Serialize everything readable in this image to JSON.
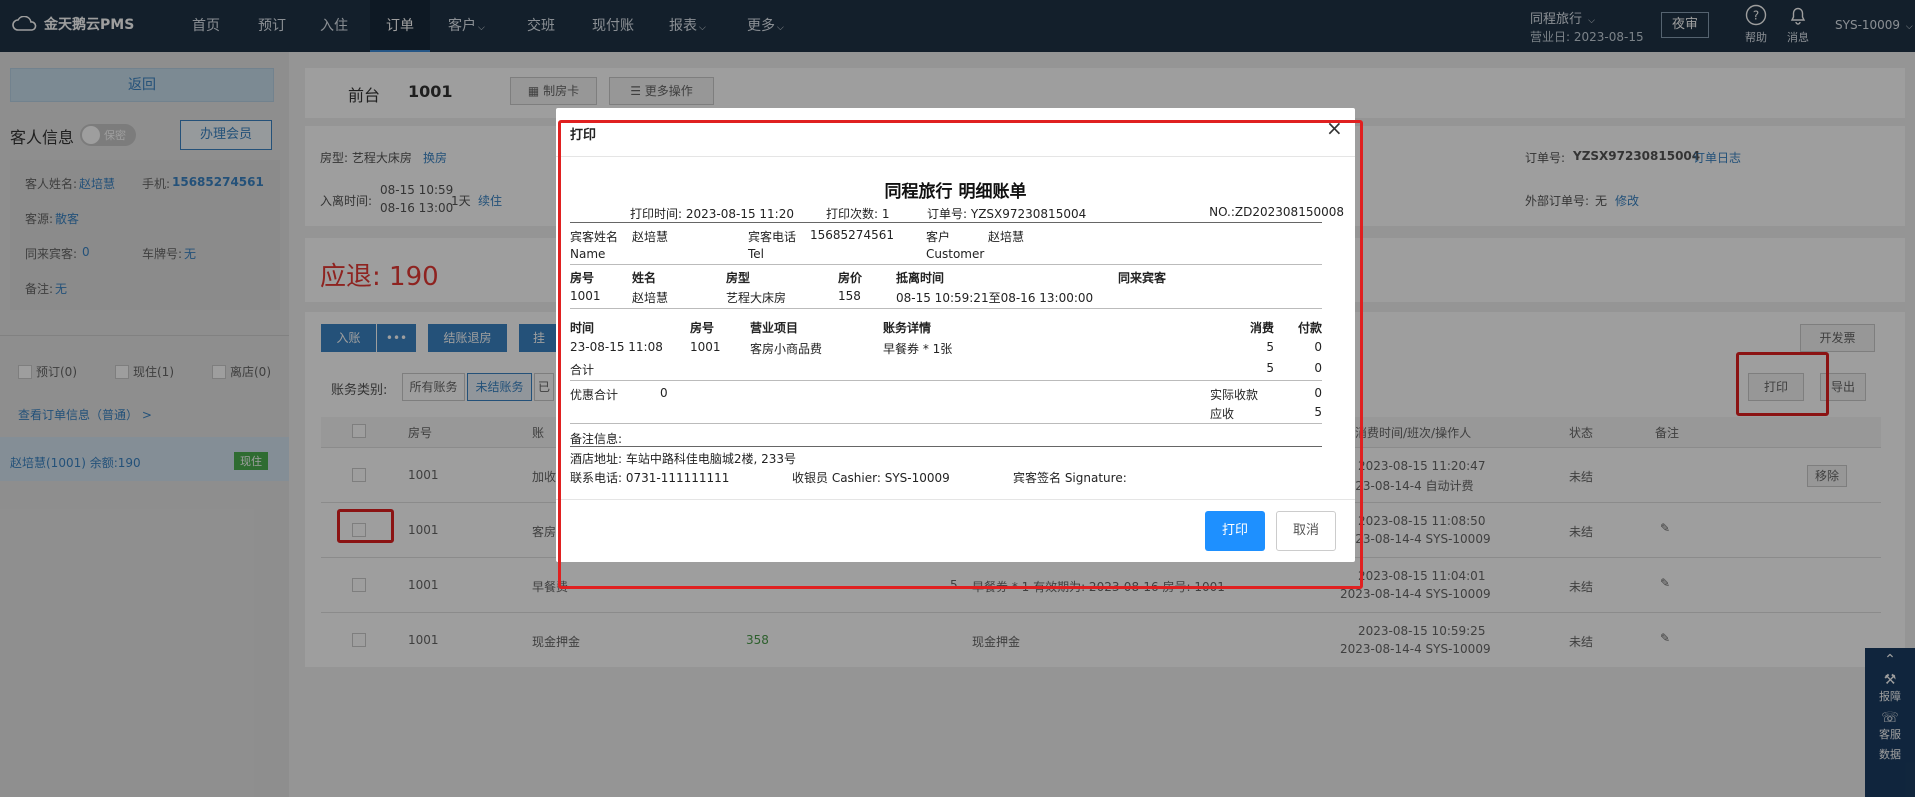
{
  "nav": {
    "logo": "金天鹅云PMS",
    "items": [
      "首页",
      "预订",
      "入住",
      "订单",
      "客户",
      "交班",
      "现付账",
      "报表",
      "更多"
    ],
    "active": "订单",
    "hotel": "同程旅行",
    "business_date": "营业日: 2023-08-15",
    "night_audit": "夜审",
    "help": "帮助",
    "message": "消息",
    "user": "SYS-10009"
  },
  "left": {
    "return": "返回",
    "guest_info": "客人信息",
    "secret": "保密",
    "member_btn": "办理会员",
    "guest_name_label": "客人姓名:",
    "guest_name": "赵培慧",
    "phone_label": "手机:",
    "phone": "15685274561",
    "source_label": "客源:",
    "source": "散客",
    "companion_label": "同来宾客:",
    "companion": "0",
    "plate_label": "车牌号:",
    "plate": "无",
    "remark_label": "备注:",
    "remark": "无",
    "filters": [
      "预订(0)",
      "现住(1)",
      "离店(0)"
    ],
    "order_info": "查看订单信息（普通） >",
    "guest_row": "赵培慧(1001)  余额:190",
    "guest_row_status": "现住"
  },
  "main": {
    "title": "前台",
    "room": "1001",
    "make_card": "制房卡",
    "more_ops": "更多操作",
    "room_type": "房型: 艺程大床房",
    "change_room": "换房",
    "checkin_label": "入离时间:",
    "checkin": "08-15 10:59",
    "checkout": "08-16 13:00",
    "nights": "1天",
    "extend": "续住",
    "order_no_label": "订单号:",
    "order_no": "YZSX97230815004",
    "order_log": "订单日志",
    "ext_order_label": "外部订单号:",
    "ext_order": "无",
    "modify": "修改",
    "refund": "应退: 190",
    "btn_post": "入账",
    "btn_settle": "结账退房",
    "btn_other": "挂",
    "btn_invoice": "开发票",
    "btn_print": "打印",
    "btn_export": "导出",
    "acct_type_label": "账务类别:",
    "acct_all": "所有账务",
    "acct_unsettled": "未结账务",
    "acct_settled": "已",
    "table": {
      "headers": [
        "房号",
        "账",
        "消费时间/班次/操作人",
        "状态",
        "备注"
      ],
      "rows": [
        {
          "room": "1001",
          "item": "加收",
          "amount": "",
          "desc": "",
          "time": "2023-08-15 11:20:47",
          "shift": "2023-08-14-4 自动计费",
          "status": "未结",
          "extra": "移除"
        },
        {
          "room": "1001",
          "item": "客房",
          "amount": "",
          "desc": "",
          "time": "2023-08-15 11:08:50",
          "shift": "2023-08-14-4 SYS-10009",
          "status": "未结",
          "extra": ""
        },
        {
          "room": "1001",
          "item": "早餐费",
          "amount": "5",
          "desc": "早餐券 * 1  有效期为: 2023-08-16  房号: 1001",
          "time": "2023-08-15 11:04:01",
          "shift": "2023-08-14-4 SYS-10009",
          "status": "未结",
          "extra": ""
        },
        {
          "room": "1001",
          "item": "现金押金",
          "amount": "358",
          "desc": "现金押金",
          "time": "2023-08-15 10:59:25",
          "shift": "2023-08-14-4 SYS-10009",
          "status": "未结",
          "extra": ""
        }
      ]
    }
  },
  "modal": {
    "title": "打印",
    "doc_title": "同程旅行 明细账单",
    "print_time": "打印时间: 2023-08-15 11:20",
    "print_count": "打印次数: 1",
    "order_no": "订单号: YZSX97230815004",
    "doc_no": "NO.:ZD202308150008",
    "guest_name_label": "宾客姓名",
    "guest_name_en": "Name",
    "guest_name": "赵培慧",
    "guest_tel_label": "宾客电话",
    "guest_tel_en": "Tel",
    "guest_tel": "15685274561",
    "customer_label": "客户",
    "customer_en": "Customer",
    "customer": "赵培慧",
    "room_headers": [
      "房号",
      "姓名",
      "房型",
      "房价",
      "抵离时间",
      "同来宾客"
    ],
    "room_row": [
      "1001",
      "赵培慧",
      "艺程大床房",
      "158",
      "08-15 10:59:21至08-16 13:00:00",
      ""
    ],
    "bill_headers": [
      "时间",
      "房号",
      "营业项目",
      "账务详情",
      "消费",
      "付款"
    ],
    "bill_row": [
      "23-08-15 11:08",
      "1001",
      "客房小商品费",
      "早餐券 * 1张",
      "5",
      "0"
    ],
    "total_label": "合计",
    "total_consume": "5",
    "total_pay": "0",
    "discount_label": "优惠合计",
    "discount": "0",
    "actual_label": "实际收款",
    "actual": "0",
    "receivable_label": "应收",
    "receivable": "5",
    "remark_label": "备注信息:",
    "address": "酒店地址:  车站中路科佳电脑城2楼, 233号",
    "contact": "联系电话:  0731-111111111",
    "cashier": "收银员 Cashier:  SYS-10009",
    "signature": "宾客签名 Signature:",
    "btn_print": "打印",
    "btn_cancel": "取消",
    "close": "×"
  },
  "side": {
    "report": "报障",
    "service": "客服",
    "data": "数据"
  },
  "colors": {
    "nav": "#1f3346",
    "accent": "#1e90ff",
    "highlight": "#e02020",
    "link": "#3a84c4"
  }
}
